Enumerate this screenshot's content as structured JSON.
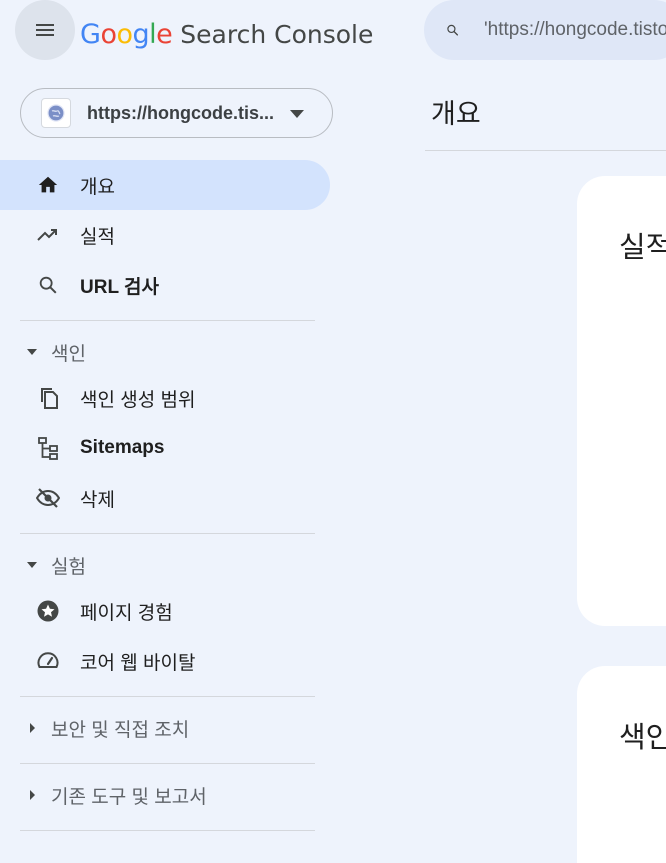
{
  "app": {
    "google": "Google",
    "product": "Search Console"
  },
  "search": {
    "value": "'https://hongcode.tistory.com'"
  },
  "property": {
    "url": "https://hongcode.tis..."
  },
  "nav": {
    "overview": "개요",
    "performance": "실적",
    "url_inspection": "URL 검사",
    "index_section": "색인",
    "index_coverage": "색인 생성 범위",
    "sitemaps": "Sitemaps",
    "removals": "삭제",
    "experience_section": "실험",
    "page_experience": "페이지 경험",
    "core_web_vitals": "코어 웹 바이탈",
    "security_section": "보안 및 직접 조치",
    "legacy_section": "기존 도구 및 보고서"
  },
  "main": {
    "title": "개요",
    "cards": [
      "실적",
      "색인"
    ]
  },
  "colors": {
    "blue": "#4285F4",
    "red": "#EA4335",
    "yellow": "#FBBC05",
    "green": "#34A853",
    "active_bg": "#d3e3fd"
  }
}
